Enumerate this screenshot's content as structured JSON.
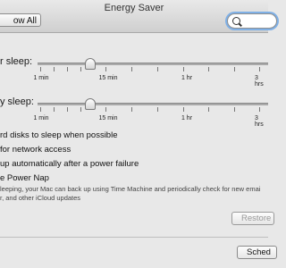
{
  "window": {
    "title": "Energy Saver"
  },
  "toolbar": {
    "show_all_label": "ow All",
    "search_value": ""
  },
  "sliders": [
    {
      "label": "r sleep:",
      "ticks": [
        "1 min",
        "15 min",
        "1 hr",
        "3 hrs"
      ]
    },
    {
      "label": "y sleep:",
      "ticks": [
        "1 min",
        "15 min",
        "1 hr",
        "3 hrs"
      ]
    }
  ],
  "options": {
    "hard_disks": "rd disks to sleep when possible",
    "network": "for network access",
    "power_failure": "up automatically after a power failure",
    "power_nap": "e Power Nap",
    "power_nap_desc_1": "leeping, your Mac can back up using Time Machine and periodically check for new emai",
    "power_nap_desc_2": "r, and other iCloud updates"
  },
  "buttons": {
    "restore": "Restore",
    "schedule": "Sched"
  }
}
